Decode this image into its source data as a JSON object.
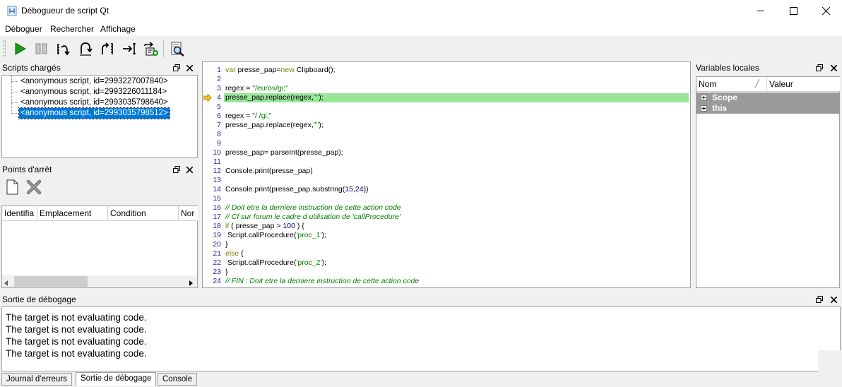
{
  "window": {
    "title": "Débogueur de script Qt"
  },
  "menu": {
    "items": [
      "Déboguer",
      "Rechercher",
      "Affichage"
    ]
  },
  "toolbar": {
    "buttons": [
      "continue-icon",
      "interrupt-icon",
      "step-into-icon",
      "step-over-icon",
      "step-out-icon",
      "run-to-cursor-icon",
      "run-to-new-script-icon",
      "find-in-script-icon"
    ]
  },
  "scripts_panel": {
    "title": "Scripts chargés",
    "scripts": [
      "<anonymous script, id=2993227007840>",
      "<anonymous script, id=2993226011184>",
      "<anonymous script, id=2993035798640>",
      "<anonymous script, id=2993035798512>"
    ],
    "selected_index": 3
  },
  "breakpoints_panel": {
    "title": "Points d'arrêt",
    "columns": [
      "Identifia",
      "Emplacement",
      "Condition",
      "Nor"
    ]
  },
  "code": {
    "current_line": 4,
    "lines": [
      "var presse_pap=new Clipboard();",
      "",
      "regex = \"/euros/gi;\"",
      "presse_pap.replace(regex,\"\");",
      "",
      "regex = \"/ /gi;\"",
      "presse_pap.replace(regex,\"\");",
      "",
      "",
      "presse_pap= parseInt(presse_pap);",
      "",
      "Console.print(presse_pap)",
      "",
      "Console.print(presse_pap.substring(15,24))",
      "",
      "// Doit etre la derniere instruction de cette action code",
      "// Cf sur forum le cadre d utilisation de 'callProcedure'",
      "if ( presse_pap > 100 ) {",
      " Script.callProcedure('proc_1');",
      "}",
      "else {",
      " Script.callProcedure('proc_2');",
      "}",
      "// FIN : Doit etre la derniere instruction de cette action code"
    ]
  },
  "locals_panel": {
    "title": "Variables locales",
    "columns": [
      "Nom",
      "Valeur"
    ],
    "rows": [
      "Scope",
      "this"
    ]
  },
  "debug_panel": {
    "title": "Sortie de débogage",
    "lines": [
      "The target is not evaluating code.",
      "The target is not evaluating code.",
      "The target is not evaluating code.",
      "The target is not evaluating code."
    ]
  },
  "bottom_tabs": {
    "items": [
      "Journal d'erreurs",
      "Sortie de débogage",
      "Console"
    ],
    "active_index": 1
  }
}
